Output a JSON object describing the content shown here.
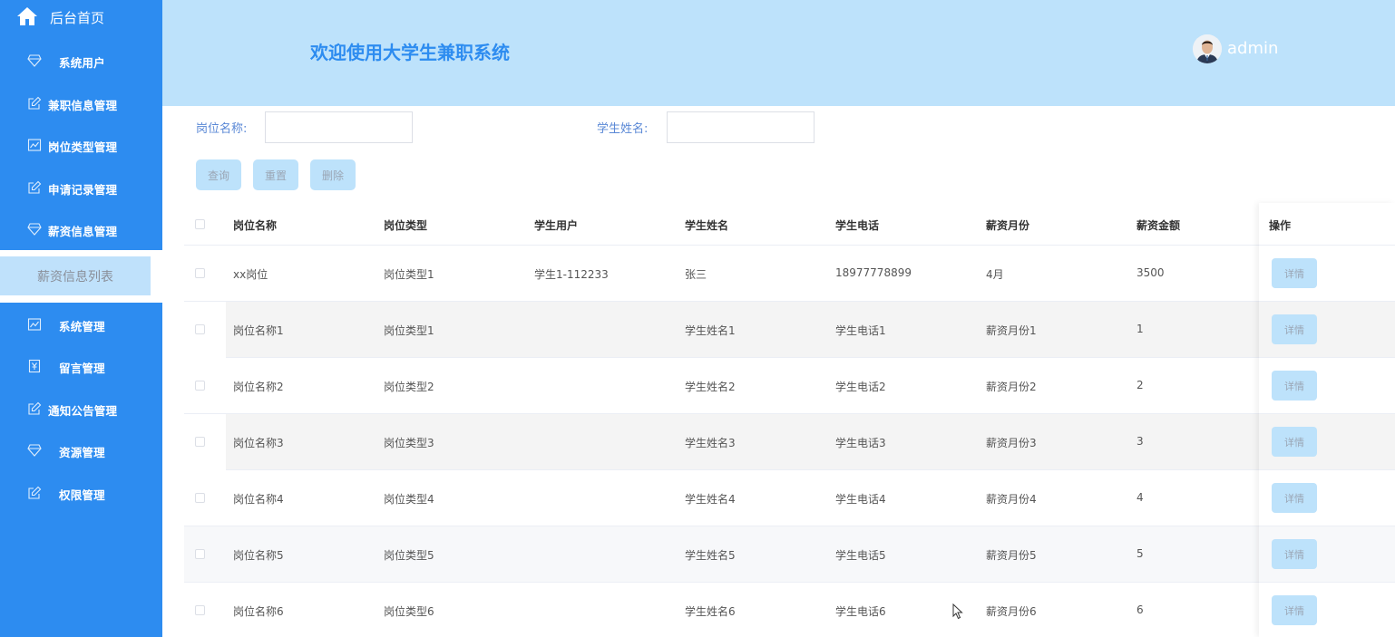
{
  "sidebar": {
    "home_label": "后台首页",
    "items": [
      {
        "label": "系统用户",
        "icon": "diamond-icon"
      },
      {
        "label": "兼职信息管理",
        "icon": "edit-icon"
      },
      {
        "label": "岗位类型管理",
        "icon": "chart-icon"
      },
      {
        "label": "申请记录管理",
        "icon": "edit-icon"
      },
      {
        "label": "薪资信息管理",
        "icon": "diamond-icon"
      },
      {
        "label": "系统管理",
        "icon": "chart-icon"
      },
      {
        "label": "留言管理",
        "icon": "yen-icon"
      },
      {
        "label": "通知公告管理",
        "icon": "edit-icon"
      },
      {
        "label": "资源管理",
        "icon": "diamond-icon"
      },
      {
        "label": "权限管理",
        "icon": "edit-icon"
      }
    ],
    "submenu_item": "薪资信息列表"
  },
  "header": {
    "title": "欢迎使用大学生兼职系统",
    "username": "admin"
  },
  "search": {
    "position_label": "岗位名称:",
    "position_value": "",
    "student_label": "学生姓名:",
    "student_value": "",
    "query_button": "查询",
    "reset_button": "重置",
    "delete_button": "删除"
  },
  "table": {
    "columns": [
      "岗位名称",
      "岗位类型",
      "学生用户",
      "学生姓名",
      "学生电话",
      "薪资月份",
      "薪资金额",
      "操作"
    ],
    "detail_label": "详情",
    "rows": [
      [
        "xx岗位",
        "岗位类型1",
        "学生1-112233",
        "张三",
        "18977778899",
        "4月",
        "3500"
      ],
      [
        "岗位名称1",
        "岗位类型1",
        "",
        "学生姓名1",
        "学生电话1",
        "薪资月份1",
        "1"
      ],
      [
        "岗位名称2",
        "岗位类型2",
        "",
        "学生姓名2",
        "学生电话2",
        "薪资月份2",
        "2"
      ],
      [
        "岗位名称3",
        "岗位类型3",
        "",
        "学生姓名3",
        "学生电话3",
        "薪资月份3",
        "3"
      ],
      [
        "岗位名称4",
        "岗位类型4",
        "",
        "学生姓名4",
        "学生电话4",
        "薪资月份4",
        "4"
      ],
      [
        "岗位名称5",
        "岗位类型5",
        "",
        "学生姓名5",
        "学生电话5",
        "薪资月份5",
        "5"
      ],
      [
        "岗位名称6",
        "岗位类型6",
        "",
        "学生姓名6",
        "学生电话6",
        "薪资月份6",
        "6"
      ]
    ]
  },
  "colors": {
    "sidebar_bg": "#2d8cf0",
    "header_bg": "#bde2fb",
    "accent": "#2d8cf0",
    "button_bg": "#bde2fb"
  }
}
